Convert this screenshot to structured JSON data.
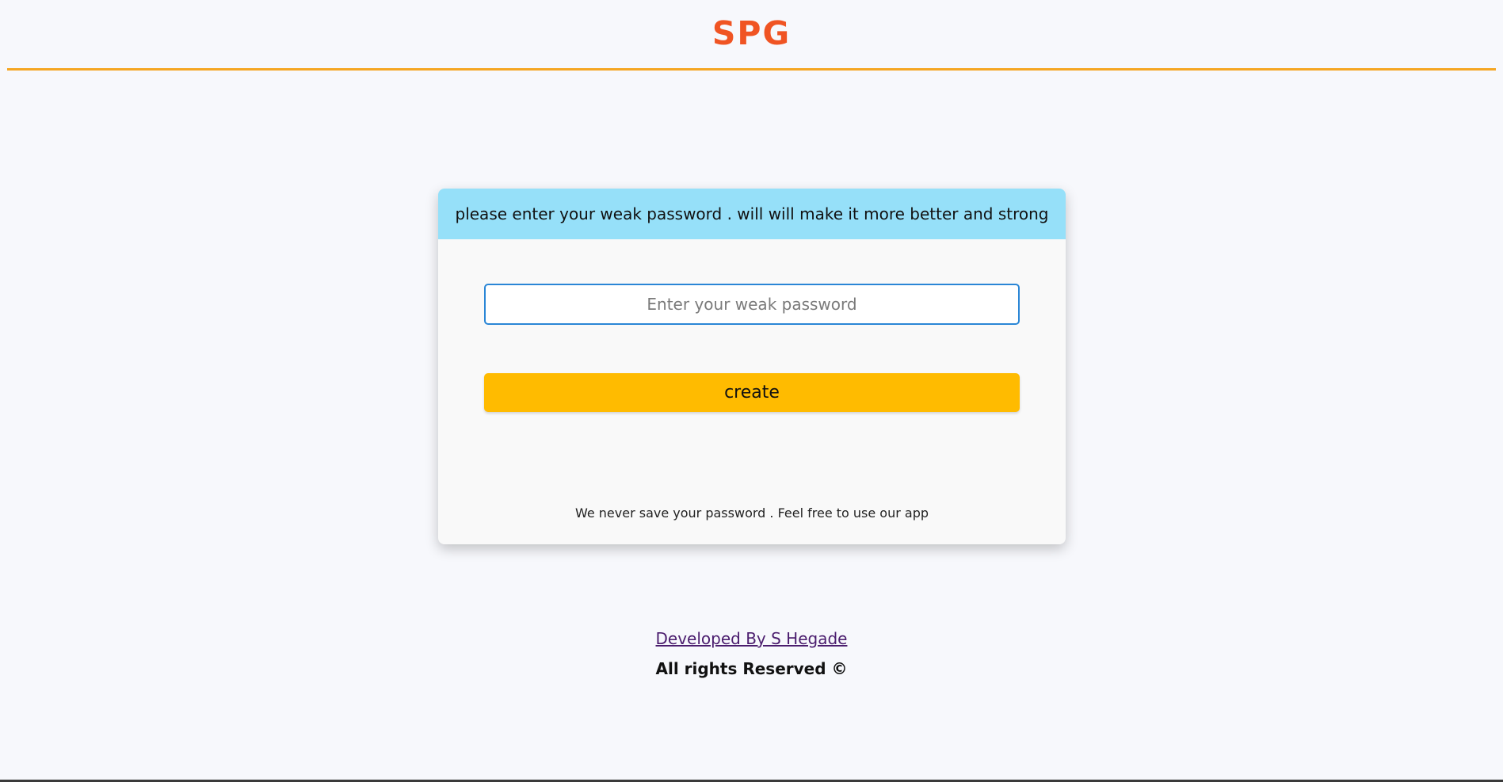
{
  "header": {
    "logo": "SPG"
  },
  "card": {
    "banner_text": "please enter your weak password . will will make it more better and strong",
    "input_placeholder": "Enter your weak password",
    "input_value": "",
    "create_label": "create",
    "privacy_note": "We never save your password . Feel free to use our app"
  },
  "footer": {
    "developer_link": "Developed By S Hegade",
    "rights": "All rights Reserved ©"
  },
  "colors": {
    "logo": "#f05423",
    "header_rule": "#f5a623",
    "banner": "#96e0f9",
    "button": "#ffbb00",
    "input_border": "#2a86d6",
    "link": "#4b1d6e"
  }
}
